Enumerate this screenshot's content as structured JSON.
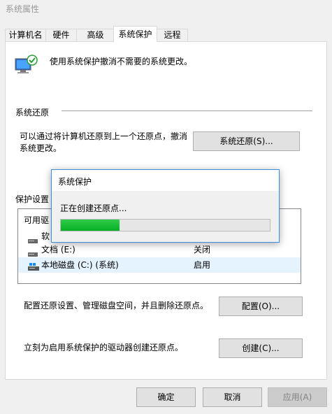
{
  "window": {
    "title": "系统属性"
  },
  "tabs": [
    {
      "label": "计算机名"
    },
    {
      "label": "硬件"
    },
    {
      "label": "高级"
    },
    {
      "label": "系统保护",
      "active": true
    },
    {
      "label": "远程"
    }
  ],
  "header": {
    "description": "使用系统保护撤消不需要的系统更改。"
  },
  "restore_section": {
    "heading": "系统还原",
    "description_line1": "可以通过将计算机还原到上一个还原点，撤消",
    "description_line2": "系统更改。",
    "button_label": "系统还原(S)..."
  },
  "protection_section": {
    "heading": "保护设置",
    "column_header": "可用驱",
    "drives": [
      {
        "name": "软",
        "status": ""
      },
      {
        "name": "文档 (E:)",
        "status": "关闭"
      },
      {
        "name": "本地磁盘 (C:) (系统)",
        "status": "启用"
      }
    ]
  },
  "configure": {
    "description": "配置还原设置、管理磁盘空间，并且删除还原点。",
    "button_label": "配置(O)..."
  },
  "create": {
    "description": "立刻为启用系统保护的驱动器创建还原点。",
    "button_label": "创建(C)..."
  },
  "footer": {
    "ok_label": "确定",
    "cancel_label": "取消",
    "apply_label": "应用(A)"
  },
  "dialog": {
    "title": "系统保护",
    "message": "正在创建还原点...",
    "progress": 0.28
  },
  "colors": {
    "accent": "#3c8ee0",
    "progress": "#06b025"
  }
}
